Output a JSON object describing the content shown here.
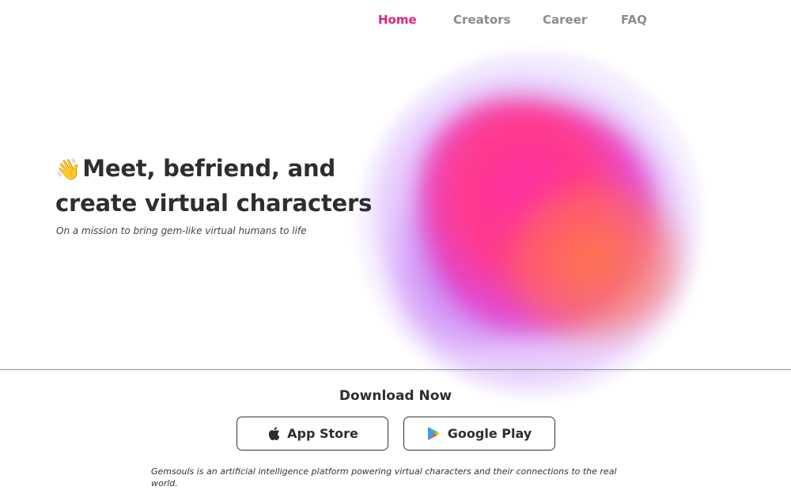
{
  "nav": {
    "items": [
      {
        "label": "Home",
        "active": true
      },
      {
        "label": "Creators",
        "active": false
      },
      {
        "label": "Career",
        "active": false
      },
      {
        "label": "FAQ",
        "active": false
      }
    ]
  },
  "hero": {
    "wave_icon": "👋",
    "title": "Meet, befriend, and create virtual characters",
    "subtitle": "On a mission to bring gem-like virtual humans to life"
  },
  "download": {
    "title": "Download Now",
    "app_store_label": "App Store",
    "app_store_icon": "apple-icon",
    "google_play_label": "Google Play",
    "google_play_icon": "google-play-icon"
  },
  "footer": {
    "description": "Gemsouls is an artificial intelligence platform powering virtual characters and their connections to the real world."
  },
  "colors": {
    "accent": "#e0217a",
    "nav_inactive": "#8c8c8c",
    "text_dark": "#2e2e2e"
  }
}
